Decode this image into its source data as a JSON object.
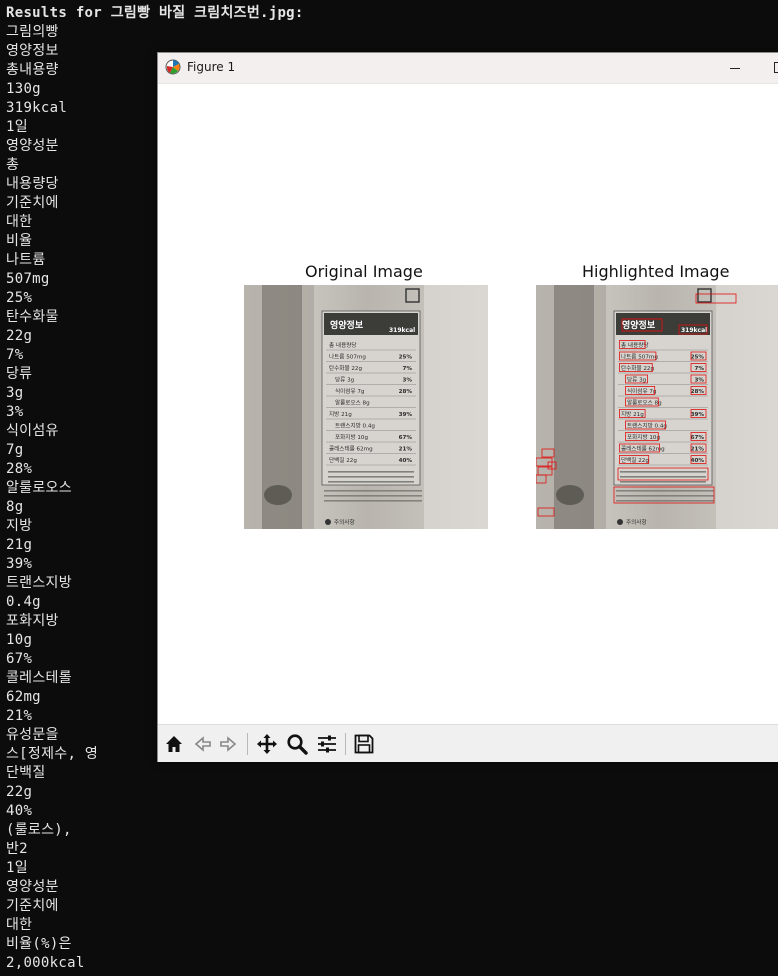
{
  "terminal": {
    "lines": [
      "Results for 그림빵 바질 크림치즈번.jpg:",
      "그림의빵",
      "영양정보",
      "총내용량",
      "130g",
      "319kcal",
      "1일",
      "영양성분",
      "총",
      "내용량당",
      "기준치에",
      "대한",
      "비율",
      "나트륨",
      "507mg",
      "25%",
      "탄수화물",
      "22g",
      "7%",
      "당류",
      "3g",
      "3%",
      "식이섬유",
      "7g",
      "28%",
      "알룰로오스",
      "8g",
      "지방",
      "21g",
      "39%",
      "트랜스지방",
      "0.4g",
      "포화지방",
      "10g",
      "67%",
      "콜레스테롤",
      "62mg",
      "21%",
      "유성문을",
      "스[정제수, 영",
      "단백질",
      "22g",
      "40%",
      "(룰로스),",
      "반2",
      "1일",
      "영양성분",
      "기준치에",
      "대한",
      "비율(%)은",
      "2,000kcal"
    ]
  },
  "window": {
    "title": "Figure 1",
    "left_title": "Original Image",
    "right_title": "Highlighted Image"
  },
  "label": {
    "heading": "영양정보",
    "kcal": "319kcal",
    "rows": [
      {
        "name": "총 내용량당",
        "pct": ""
      },
      {
        "name": "나트륨 507mg",
        "pct": "25%"
      },
      {
        "name": "탄수화물 22g",
        "pct": "7%"
      },
      {
        "name": "당류 3g",
        "pct": "3%"
      },
      {
        "name": "식이섬유 7g",
        "pct": "28%"
      },
      {
        "name": "알룰로오스 8g",
        "pct": ""
      },
      {
        "name": "지방 21g",
        "pct": "39%"
      },
      {
        "name": "트랜스지방 0.4g",
        "pct": ""
      },
      {
        "name": "포화지방 10g",
        "pct": "67%"
      },
      {
        "name": "콜레스테롤 62mg",
        "pct": "21%"
      },
      {
        "name": "단백질 22g",
        "pct": "40%"
      }
    ],
    "warning": "주의사항"
  },
  "toolbar": {
    "icons": [
      "home-icon",
      "back-icon",
      "forward-icon",
      "pan-icon",
      "zoom-icon",
      "configure-icon",
      "save-icon"
    ]
  }
}
